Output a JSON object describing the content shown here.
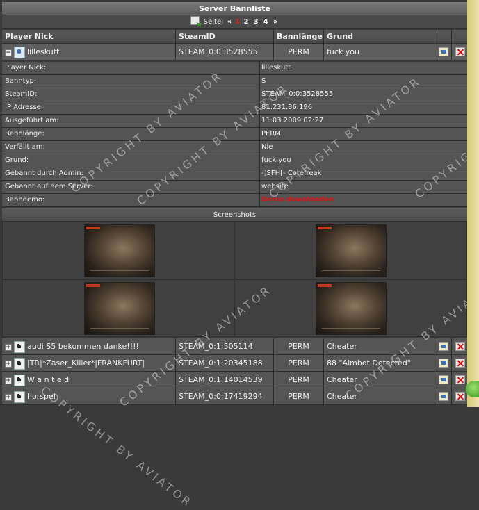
{
  "title": "Server Bannliste",
  "pager": {
    "label": "Seite:",
    "prev": "«",
    "current": "1",
    "pages": [
      "2",
      "3",
      "4"
    ],
    "next": "»"
  },
  "columns": {
    "nick": "Player Nick",
    "steamid": "SteamID",
    "length": "Bannlänge",
    "reason": "Grund"
  },
  "expanded_player": {
    "nick": "lilleskutt",
    "steamid": "STEAM_0:0:3528555",
    "length": "PERM",
    "reason": "fuck you",
    "toggle": "−"
  },
  "details": [
    {
      "label": "Player Nick:",
      "value": "lilleskutt"
    },
    {
      "label": "Banntyp:",
      "value": "S"
    },
    {
      "label": "SteamID:",
      "value": "STEAM_0:0:3528555"
    },
    {
      "label": "IP Adresse:",
      "value": "81.231.36.196"
    },
    {
      "label": "Ausgeführt am:",
      "value": "11.03.2009 02:27"
    },
    {
      "label": "Bannlänge:",
      "value": "PERM"
    },
    {
      "label": "Verfällt am:",
      "value": "Nie"
    },
    {
      "label": "Grund:",
      "value": "fuck you"
    },
    {
      "label": "Gebannt durch Admin:",
      "value": "-]SFH[- Corefreak"
    },
    {
      "label": "Gebannt auf dem Server:",
      "value": "website"
    },
    {
      "label": "Banndemo:",
      "value": "Demo downloaden"
    }
  ],
  "screenshots_label": "Screenshots",
  "players": [
    {
      "nick": "audi S5 bekommen danke!!!!",
      "steamid": "STEAM_0:1:505114",
      "length": "PERM",
      "reason": "Cheater",
      "toggle": "+"
    },
    {
      "nick": "|TR|*Zaser_Killer*|FRANKFURT|",
      "steamid": "STEAM_0:1:20345188",
      "length": "PERM",
      "reason": "88 \"Aimbot Detected\"",
      "toggle": "+"
    },
    {
      "nick": "W a n t e d",
      "steamid": "STEAM_0:1:14014539",
      "length": "PERM",
      "reason": "Cheater",
      "toggle": "+"
    },
    {
      "nick": "horspel",
      "steamid": "STEAM_0:0:17419294",
      "length": "PERM",
      "reason": "Cheater",
      "toggle": "+"
    }
  ],
  "watermark": "COPYRIGHT BY AVIATOR",
  "colors": {
    "background": "#3a3a3a",
    "header": "#5e5e5e",
    "accent_red": "#dd1111",
    "side_strip": "#e6d68e"
  }
}
